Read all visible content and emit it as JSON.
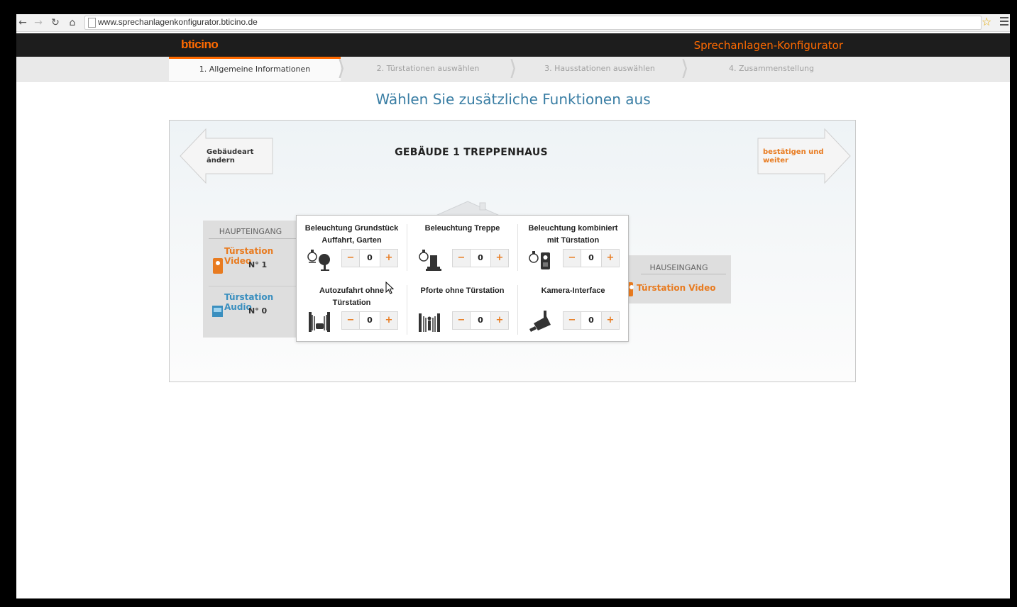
{
  "browser": {
    "url": "www.sprechanlagenkonfigurator.bticino.de"
  },
  "header": {
    "logo": "bticino",
    "title": "Sprechanlagen-Konfigurator",
    "accent": "#ff6a00"
  },
  "steps": [
    {
      "label": "1. Allgemeine Informationen",
      "active": true
    },
    {
      "label": "2. Türstationen auswählen",
      "active": false
    },
    {
      "label": "3. Hausstationen auswählen",
      "active": false
    },
    {
      "label": "4. Zusammenstellung",
      "active": false
    }
  ],
  "page_title": "Wählen Sie zusätzliche Funktionen aus",
  "panel": {
    "back_label": "Gebäudeart ändern",
    "back_line1": "Gebäudeart",
    "back_line2": "ändern",
    "building_title": "GEBÄUDE 1 TREPPENHAUS",
    "next_line1": "bestätigen und",
    "next_line2": "weiter"
  },
  "haupteingang": {
    "label": "HAUPTEINGANG",
    "stations": [
      {
        "name": "Türstation Video",
        "count": "N° 1",
        "color": "#e87b20"
      },
      {
        "name": "Türstation Audio",
        "count": "N° 0",
        "color": "#3a8fbf"
      }
    ]
  },
  "hauseingang": {
    "label": "HAUSEINGANG",
    "station": "Türstation Video"
  },
  "functions": [
    {
      "title_line1": "Beleuchtung Grundstück",
      "title_line2": "Auffahrt, Garten",
      "value": "0",
      "icon": "lamp-tree-icon"
    },
    {
      "title_line1": "Beleuchtung Treppe",
      "title_line2": "",
      "value": "0",
      "icon": "lamp-stairs-icon"
    },
    {
      "title_line1": "Beleuchtung kombiniert",
      "title_line2": "mit Türstation",
      "value": "0",
      "icon": "lamp-doorstation-icon"
    },
    {
      "title_line1": "Autozufahrt ohne",
      "title_line2": "Türstation",
      "value": "0",
      "icon": "garage-gate-icon"
    },
    {
      "title_line1": "Pforte ohne Türstation",
      "title_line2": "",
      "value": "0",
      "icon": "gate-icon"
    },
    {
      "title_line1": "Kamera-Interface",
      "title_line2": "",
      "value": "0",
      "icon": "camera-icon"
    }
  ],
  "stepper": {
    "minus": "−",
    "plus": "+"
  }
}
